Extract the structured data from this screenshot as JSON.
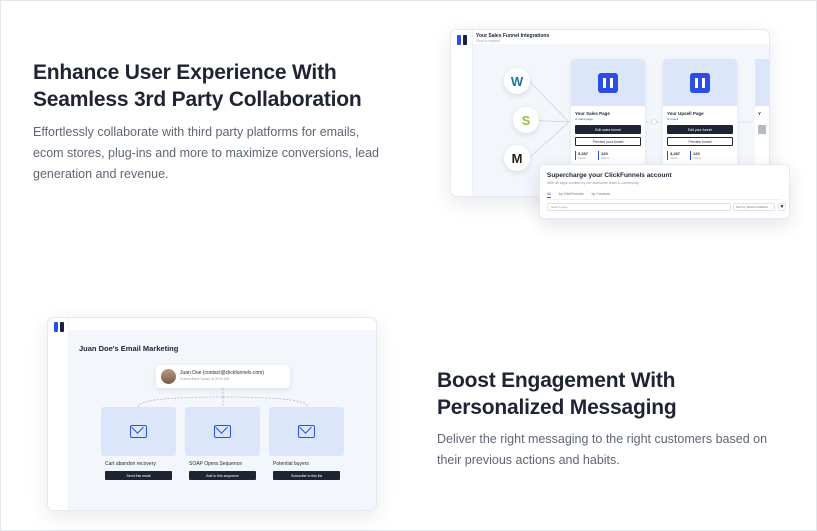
{
  "section1": {
    "heading_line1": "Enhance User Experience With",
    "heading_line2": "Seamless 3rd Party Collaboration",
    "paragraph_line1": "Effortlessly collaborate with third party platforms for emails,",
    "paragraph_line2": "ecom stores, plug-ins and more to maximize conversions, lead",
    "paragraph_line3": "generation and revenue."
  },
  "section2": {
    "heading_line1": "Boost Engagement With",
    "heading_line2": "Personalized Messaging",
    "paragraph_line1": "Deliver the right messaging to the right customers based on",
    "paragraph_line2": "their previous actions and habits."
  },
  "mock1": {
    "title": "Your Sales Funnel Integrations",
    "subtitle": "Click to expand",
    "integrations": [
      {
        "icon": "wordpress-icon",
        "glyph": "W",
        "color": "#21759b"
      },
      {
        "icon": "shopify-icon",
        "glyph": "S",
        "color": "#95bf47"
      },
      {
        "icon": "mailchimp-icon",
        "glyph": "M",
        "color": "#241c15"
      }
    ],
    "cards": [
      {
        "name": "Your Sales Page",
        "link": "cf-sales-page",
        "primary": "Edit sales funnel",
        "secondary": "Preview your funnel",
        "stat1_value": "3,287",
        "stat1_label": "Views",
        "stat2_value": "120",
        "stat2_label": "Optins"
      },
      {
        "name": "Your Upsell Page",
        "link": "cf-upsell",
        "primary": "Edit your funnel",
        "secondary": "Preview funnel",
        "stat1_value": "3,287",
        "stat1_label": "Views",
        "stat2_value": "120",
        "stat2_label": "Optins"
      }
    ],
    "stub_label": "Y",
    "popover": {
      "title": "Supercharge your ClickFunnels account",
      "subtitle": "With all apps created by our awesome team & community",
      "tabs": [
        "All",
        "by ClickFunnels",
        "by Creators"
      ],
      "search_placeholder": "Search apps",
      "sort": "Sort by: Recent Addition",
      "filter_icon": "filter-icon",
      "filter_glyph": "▼"
    }
  },
  "mock2": {
    "title": "Juan Doe's Email Marketing",
    "contact_name": "Juan Doe (contact@clickfunnels.com)",
    "contact_status": "Subscribed Today at 8:00 AM",
    "cards": [
      {
        "label": "Cart abandon recovery",
        "button": "Send this email"
      },
      {
        "label": "SOAP Opera Sequence",
        "button": "Add to this sequence"
      },
      {
        "label": "Potential buyers",
        "button": "Subscribe to this list"
      }
    ]
  },
  "colors": {
    "brand_blue": "#2d4ee6",
    "dark_navy": "#1e2433",
    "canvas_bg": "#f3f6fb",
    "card_thumb": "#dbe6fb"
  }
}
